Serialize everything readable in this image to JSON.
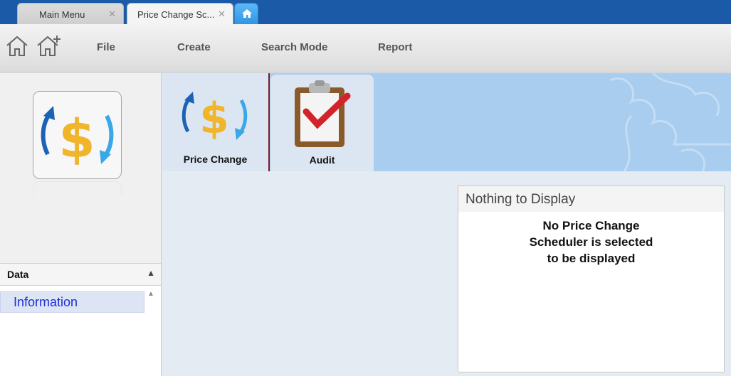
{
  "tabs": [
    {
      "label": "Main Menu"
    },
    {
      "label": "Price Change Sc..."
    }
  ],
  "toolbar": {
    "menu": [
      "File",
      "Create",
      "Search Mode",
      "Report"
    ]
  },
  "modules": [
    {
      "label": "Price Change",
      "icon": "price-change-icon"
    },
    {
      "label": "Audit",
      "icon": "audit-clipboard-icon"
    }
  ],
  "sidebar": {
    "section_title": "Data",
    "items": [
      {
        "label": "Information"
      }
    ]
  },
  "panel": {
    "title": "Nothing to Display",
    "message_lines": [
      "No Price Change",
      "Scheduler is selected",
      "to be displayed"
    ]
  },
  "colors": {
    "tabbar": "#1a5aa6",
    "selection_border": "#7a1b2a",
    "link": "#1a2fd6"
  }
}
